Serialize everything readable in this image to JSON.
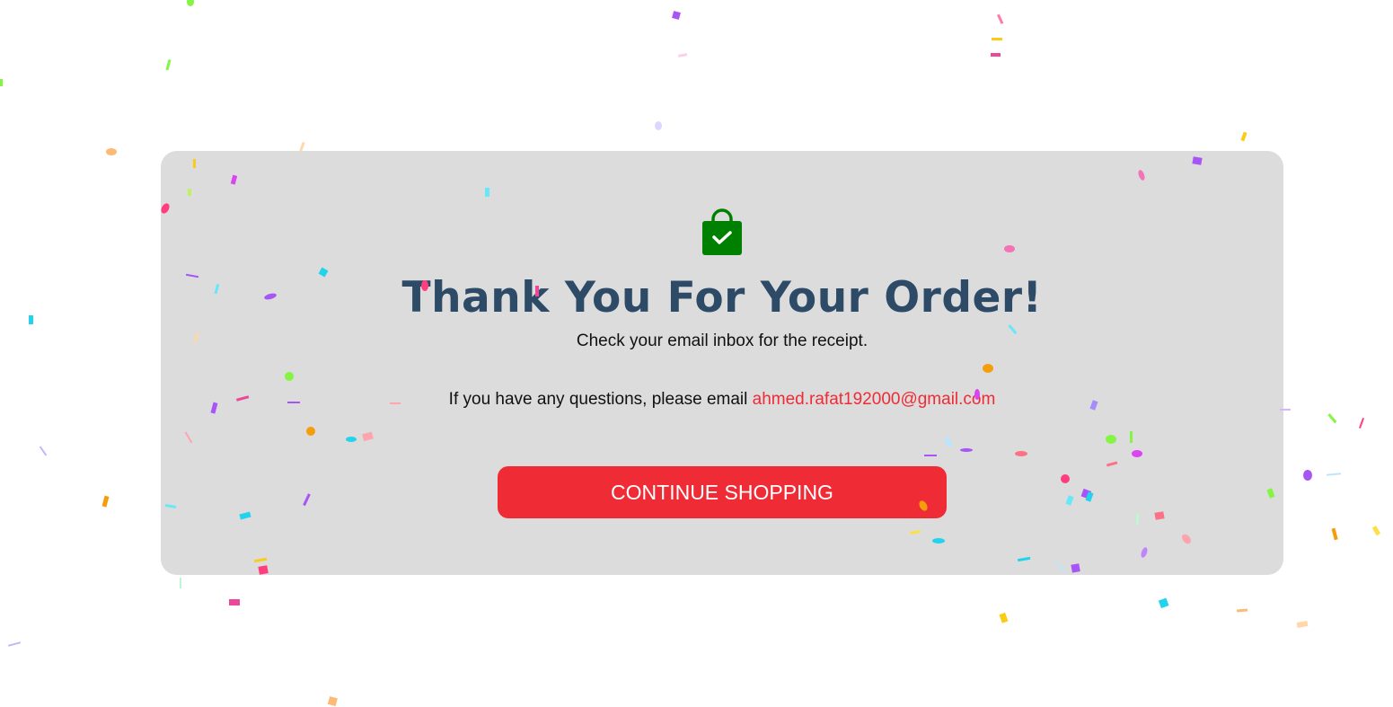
{
  "order_confirmation": {
    "icon": "shopping-bag-check-icon",
    "title": "Thank You For Your Order!",
    "subtitle": "Check your email inbox for the receipt.",
    "question_text": "If you have any questions, please email ",
    "contact_email": "ahmed.rafat192000@gmail.com",
    "continue_button_label": "CONTINUE SHOPPING"
  },
  "colors": {
    "page_background": "#ffffff",
    "card_background": "#dcdcdc",
    "title": "#2d4a67",
    "accent": "#ef2b35",
    "icon": "#008000",
    "confetti": [
      "#ff3d7f",
      "#a855f7",
      "#22d3ee",
      "#f59e0b",
      "#facc15",
      "#84f542",
      "#ec4899"
    ]
  }
}
